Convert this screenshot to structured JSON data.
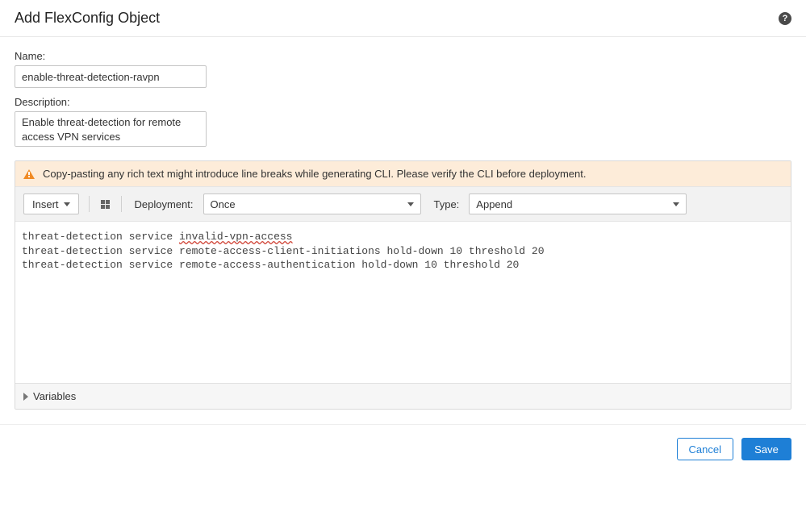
{
  "header": {
    "title": "Add FlexConfig Object",
    "help_icon": "?"
  },
  "form": {
    "name_label": "Name:",
    "name_value": "enable-threat-detection-ravpn",
    "description_label": "Description:",
    "description_value": "Enable threat-detection for remote access VPN services"
  },
  "warning": {
    "text": "Copy-pasting any rich text might introduce line breaks while generating CLI. Please verify the CLI before deployment."
  },
  "toolbar": {
    "insert_label": "Insert",
    "deployment_label": "Deployment:",
    "deployment_value": "Once",
    "type_label": "Type:",
    "type_value": "Append"
  },
  "code": {
    "line1_a": "threat-detection service ",
    "line1_b_spell": "invalid-vpn-access",
    "line2": "threat-detection service remote-access-client-initiations hold-down 10 threshold 20",
    "line3": "threat-detection service remote-access-authentication hold-down 10 threshold 20"
  },
  "variables": {
    "label": "Variables"
  },
  "footer": {
    "cancel": "Cancel",
    "save": "Save"
  }
}
